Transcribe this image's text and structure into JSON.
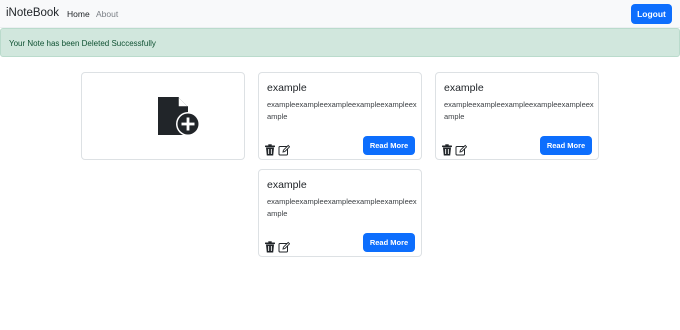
{
  "navbar": {
    "brand": "iNoteBook",
    "links": [
      "Home",
      "About"
    ],
    "logout_label": "Logout"
  },
  "alert": {
    "message": "Your Note has been Deleted Successfully"
  },
  "add_note": {
    "icon": "file-plus-icon"
  },
  "notes": [
    {
      "title": "example",
      "description": "exampleexampleexampleexampleexampleexample",
      "button_label": "Read More"
    },
    {
      "title": "example",
      "description": "exampleexampleexampleexampleexampleexample",
      "button_label": "Read More"
    },
    {
      "title": "example",
      "description": "exampleexampleexampleexampleexampleexample",
      "button_label": "Read More"
    }
  ],
  "colors": {
    "primary": "#0d6efd",
    "alert_bg": "#d1e7dd",
    "alert_text": "#0f5132"
  }
}
